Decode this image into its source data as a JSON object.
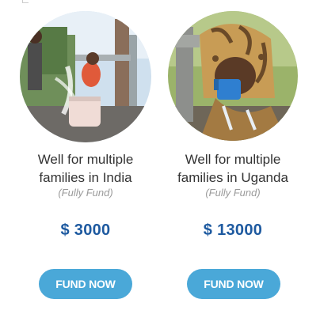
{
  "cards": [
    {
      "title_line1": "Well for multiple",
      "title_line2": "families in India",
      "subtitle": "(Fully Fund)",
      "amount": "$ 3000",
      "button_label": "FUND NOW",
      "image": "child-at-water-pump-photo"
    },
    {
      "title_line1": "Well for multiple",
      "title_line2": "families in Uganda",
      "subtitle": "(Fully Fund)",
      "amount": "$ 13000",
      "button_label": "FUND NOW",
      "image": "child-drinking-from-blue-cup-photo"
    }
  ],
  "colors": {
    "amount": "#1e5aa0",
    "button": "#4aa8d8",
    "title": "#333333",
    "subtitle": "#9a9a9a"
  }
}
